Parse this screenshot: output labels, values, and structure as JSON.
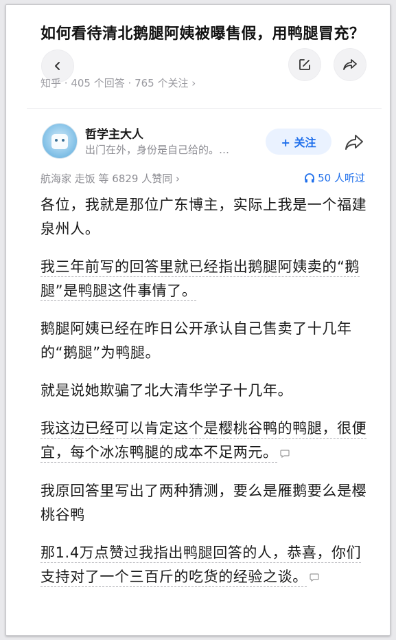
{
  "question": {
    "title": "如何看待清北鹅腿阿姨被曝售假，用鸭腿冒充？",
    "source": "知乎",
    "answers_count": "405 个回答",
    "followers_count": "765 个关注"
  },
  "author": {
    "name": "哲学主大人",
    "bio": "出门在外，身份是自己给的。…",
    "follow_label": "+ 关注"
  },
  "answer_meta": {
    "votes": "航海家 走饭 等 6829 人赞同 ›",
    "listen": "50 人听过"
  },
  "paragraphs": [
    "各位，我就是那位广东博主，实际上我是一个福建泉州人。",
    "我三年前写的回答里就已经指出鹅腿阿姨卖的“鹅腿”是鸭腿这件事情了。",
    "鹅腿阿姨已经在昨日公开承认自己售卖了十几年的“鹅腿”为鸭腿。",
    "就是说她欺骗了北大清华学子十几年。",
    "我这边已经可以肯定这个是樱桃谷鸭的鸭腿，很便宜，每个冰冻鸭腿的成本不足两元。",
    "我原回答里写出了两种猜测，要么是雁鹅要么是樱桃谷鸭",
    "那1.4万点赞过我指出鸭腿回答的人，恭喜，你们支持对了一个三百斤的吃货的经验之谈。"
  ],
  "icons": {
    "back": "chevron-left-icon",
    "edit": "edit-icon",
    "share": "share-icon",
    "headphones": "headphones-icon",
    "comment": "comment-bubble-icon"
  },
  "colors": {
    "accent": "#1f6feb",
    "muted": "#8d8d93"
  }
}
